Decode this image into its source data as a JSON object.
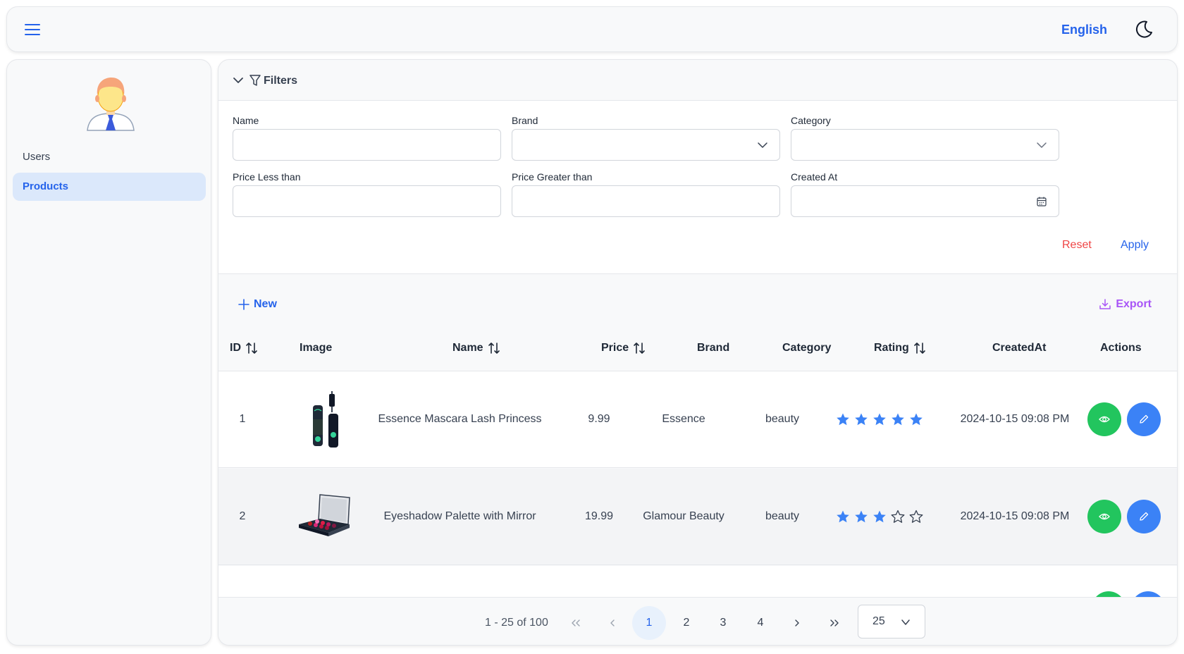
{
  "header": {
    "language": "English"
  },
  "sidebar": {
    "items": [
      {
        "label": "Users"
      },
      {
        "label": "Products"
      }
    ]
  },
  "filters": {
    "title": "Filters",
    "name_label": "Name",
    "brand_label": "Brand",
    "category_label": "Category",
    "price_lt_label": "Price Less than",
    "price_gt_label": "Price Greater than",
    "created_label": "Created At",
    "reset": "Reset",
    "apply": "Apply"
  },
  "toolbar": {
    "new": "New",
    "export": "Export"
  },
  "table": {
    "headers": {
      "id": "ID",
      "image": "Image",
      "name": "Name",
      "price": "Price",
      "brand": "Brand",
      "category": "Category",
      "rating": "Rating",
      "created": "CreatedAt",
      "actions": "Actions"
    },
    "rows": [
      {
        "id": "1",
        "name": "Essence Mascara Lash Princess",
        "price": "9.99",
        "brand": "Essence",
        "category": "beauty",
        "rating": 5,
        "created": "2024-10-15 09:08 PM"
      },
      {
        "id": "2",
        "name": "Eyeshadow Palette with Mirror",
        "price": "19.99",
        "brand": "Glamour Beauty",
        "category": "beauty",
        "rating": 3,
        "created": "2024-10-15 09:08 PM"
      }
    ]
  },
  "pagination": {
    "info": "1 - 25 of 100",
    "pages": [
      "1",
      "2",
      "3",
      "4"
    ],
    "current": "1",
    "page_size": "25"
  },
  "colors": {
    "accent": "#2563eb",
    "view": "#22c55e",
    "edit": "#3b82f6",
    "export": "#a855f7",
    "reset": "#ef4444"
  }
}
